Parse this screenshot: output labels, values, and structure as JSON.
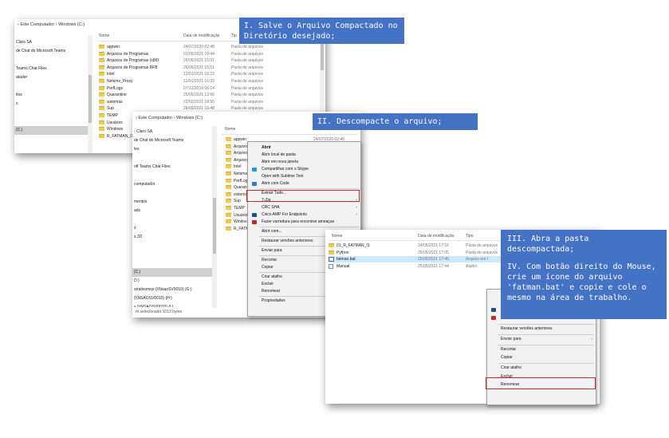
{
  "window1": {
    "crumb": [
      "Este Computador",
      "Windows (C:)"
    ],
    "sidebar": [
      "Claro SA",
      "de Chat do Microsoft Teams",
      "",
      "Teams Chat Files",
      "atador",
      "",
      "itos",
      "s",
      "",
      "",
      "(C:)"
    ],
    "headers": {
      "name": "Nome",
      "date": "Data de modificação",
      "type": "Tip"
    },
    "rows": [
      {
        "name": "appwin",
        "date": "24/07/2020 02:48",
        "type": "Pasta de arquivos"
      },
      {
        "name": "Arquivos de Programas",
        "date": "01/05/2021 18:44",
        "type": "Pasta de arquivos"
      },
      {
        "name": "Arquivos de Programas (x86)",
        "date": "26/05/2021 15:51",
        "type": "Pasta de arquivos"
      },
      {
        "name": "Arquivos de Programas RFB",
        "date": "26/05/2021 15:51",
        "type": "Pasta de arquivos"
      },
      {
        "name": "Intel",
        "date": "12/01/2021 16:23",
        "type": "Pasta de arquivos"
      },
      {
        "name": "Netsms_Proxy",
        "date": "12/01/2021 16:33",
        "type": "Pasta de arquivos"
      },
      {
        "name": "PerfLogs",
        "date": "07/12/2019 06:14",
        "type": "Pasta de arquivos"
      },
      {
        "name": "Quarantine",
        "date": "25/05/2021 13:56",
        "type": "Pasta de arquivos"
      },
      {
        "name": "sistemas",
        "date": "22/02/2021 18:56",
        "type": "Pasta de arquivos"
      },
      {
        "name": "Sup",
        "date": "26/05/2021 15:48",
        "type": "Pasta de arquivos"
      },
      {
        "name": "TEMP",
        "date": "29/01/2021 11:10",
        "type": "Pasta de arquivos"
      },
      {
        "name": "Usuários",
        "date": "",
        "type": ""
      },
      {
        "name": "Windows",
        "date": "",
        "type": ""
      },
      {
        "name": "R_FATMAN_I1",
        "date": "",
        "type": ""
      }
    ]
  },
  "window2": {
    "crumb": [
      "Este Computador",
      "Windows (C:)"
    ],
    "sidebar": [
      "- Claro SA",
      "de Chat do Microsoft Teams",
      "les",
      "",
      "oft Teams Chat Files",
      "",
      "computador",
      "",
      "mentos",
      "ads",
      "",
      "s",
      "s 3D",
      "",
      "",
      "",
      "(C:)",
      "D:)",
      "strativomso (\\\\NsaoSV0010) (G:)",
      "(\\\\NSAOSV0010) (H:)",
      "s (\\\\NSAOSV0010) (I:)",
      "e Cobrança (\\\\NSAOSV0010) (J:)",
      "ativo (\\\\NSAOSV0010) (K:)",
      "mento de Materiais (\\\\NSAOSV0010) (N:)"
    ],
    "headers": {
      "name": "Nome",
      "date": ""
    },
    "rows": [
      {
        "name": "appwin",
        "date": "24/07/2020 02:48"
      },
      {
        "name": "Arquivo",
        "date": ""
      },
      {
        "name": "Arquivo",
        "date": ""
      },
      {
        "name": "Arquivo",
        "date": ""
      },
      {
        "name": "Intel",
        "date": ""
      },
      {
        "name": "Netsms_",
        "date": ""
      },
      {
        "name": "PerfLogs",
        "date": ""
      },
      {
        "name": "Quaranti",
        "date": ""
      },
      {
        "name": "sistemas",
        "date": ""
      },
      {
        "name": "Sup",
        "date": ""
      },
      {
        "name": "TEMP",
        "date": ""
      },
      {
        "name": "Usuário",
        "date": ""
      },
      {
        "name": "Windov",
        "date": ""
      },
      {
        "name": "R_FATM",
        "date": ""
      }
    ],
    "status": "m selecionado  1013 bytes"
  },
  "menu1": {
    "items": [
      {
        "label": "Abrir",
        "bold": true,
        "arrow": false,
        "icon": ""
      },
      {
        "label": "Abrir local de pasta",
        "bold": false,
        "arrow": false,
        "icon": ""
      },
      {
        "label": "Abrir em nova janela",
        "bold": false,
        "arrow": false,
        "icon": ""
      },
      {
        "label": "Compartilhar com o Skype",
        "bold": false,
        "arrow": false,
        "icon": "#1a9ce5"
      },
      {
        "label": "Open with Sublime Text",
        "bold": false,
        "arrow": false,
        "icon": ""
      },
      {
        "label": "Abrir com Code",
        "bold": false,
        "arrow": false,
        "icon": "#2a7ad0"
      },
      {
        "sep": true
      },
      {
        "label": "Extrair Tudo...",
        "bold": false,
        "arrow": false,
        "icon": ""
      },
      {
        "label": "7-Zip",
        "bold": false,
        "arrow": true,
        "icon": ""
      },
      {
        "label": "CRC SHA",
        "bold": false,
        "arrow": true,
        "icon": ""
      },
      {
        "label": "Cisco AMP For Endpoints",
        "bold": false,
        "arrow": true,
        "icon": "#1f4e8c"
      },
      {
        "label": "Fazer varredura para encontrar ameaças",
        "bold": false,
        "arrow": false,
        "icon": "#c62828"
      },
      {
        "sep": true
      },
      {
        "label": "Abrir com...",
        "bold": false,
        "arrow": true,
        "icon": ""
      },
      {
        "sep": true
      },
      {
        "label": "Restaurar versões anteriores",
        "bold": false,
        "arrow": false,
        "icon": ""
      },
      {
        "sep": true
      },
      {
        "label": "Enviar para",
        "bold": false,
        "arrow": true,
        "icon": ""
      },
      {
        "sep": true
      },
      {
        "label": "Recortar",
        "bold": false,
        "arrow": false,
        "icon": ""
      },
      {
        "label": "Copiar",
        "bold": false,
        "arrow": false,
        "icon": ""
      },
      {
        "sep": true
      },
      {
        "label": "Criar atalho",
        "bold": false,
        "arrow": false,
        "icon": ""
      },
      {
        "label": "Excluir",
        "bold": false,
        "arrow": false,
        "icon": ""
      },
      {
        "label": "Renomear",
        "bold": false,
        "arrow": false,
        "icon": ""
      },
      {
        "sep": true
      },
      {
        "label": "Propriedades",
        "bold": false,
        "arrow": false,
        "icon": ""
      }
    ]
  },
  "window3": {
    "headers": {
      "name": "Nome",
      "date": "Data de modificação",
      "type": "Tipo"
    },
    "rows": [
      {
        "name": "01_R_FATMAN_I1",
        "date": "24/05/2021 17:16",
        "type": "Pasta de arquivos",
        "icon": "folder"
      },
      {
        "name": "Python",
        "date": "25/05/2021 17:05",
        "type": "Pasta de arquivos",
        "icon": "folder"
      },
      {
        "name": "fatman.bat",
        "date": "25/05/2021 17:45",
        "type": "Arquivo em l",
        "icon": "bat"
      },
      {
        "name": "Manual",
        "date": "25/05/2021 17:44",
        "type": "Atalho",
        "icon": "file"
      }
    ]
  },
  "menu2": {
    "items": [
      {
        "label": "Compartilhar",
        "icon": "",
        "arrow": false,
        "sep_before": false
      },
      {
        "label": "Cisco AMP For Endpoints",
        "icon": "#1f4e8c",
        "arrow": true,
        "sep_before": false
      },
      {
        "label": "Fazer varredura para encontrar ameaças",
        "icon": "#c62828",
        "arrow": false,
        "sep_before": false
      },
      {
        "label": "Restaurar versões anteriores",
        "icon": "",
        "arrow": false,
        "sep_before": true
      },
      {
        "label": "Enviar para",
        "icon": "",
        "arrow": true,
        "sep_before": true
      },
      {
        "label": "Recortar",
        "icon": "",
        "arrow": false,
        "sep_before": true
      },
      {
        "label": "Copiar",
        "icon": "",
        "arrow": false,
        "sep_before": false
      },
      {
        "label": "Criar atalho",
        "icon": "",
        "arrow": false,
        "sep_before": true
      },
      {
        "label": "Excluir",
        "icon": "",
        "arrow": false,
        "sep_before": false
      },
      {
        "label": "Renomear",
        "icon": "",
        "arrow": false,
        "sep_before": false
      }
    ]
  },
  "callouts": {
    "step1": "I. Salve o Arquivo Compactado no Diretório desejado;",
    "step2": "II. Descompacte o arquivo;",
    "step3": "III. Abra a pasta descompactada;",
    "step4": "IV. Com botão direito do Mouse, crie um ícone do arquivo 'fatman.bat' e copie e cole o mesmo na área de trabalho."
  },
  "colors": {
    "callout": "#4472c4",
    "highlight": "#cc2b2b",
    "selection": "#cce8ff"
  }
}
